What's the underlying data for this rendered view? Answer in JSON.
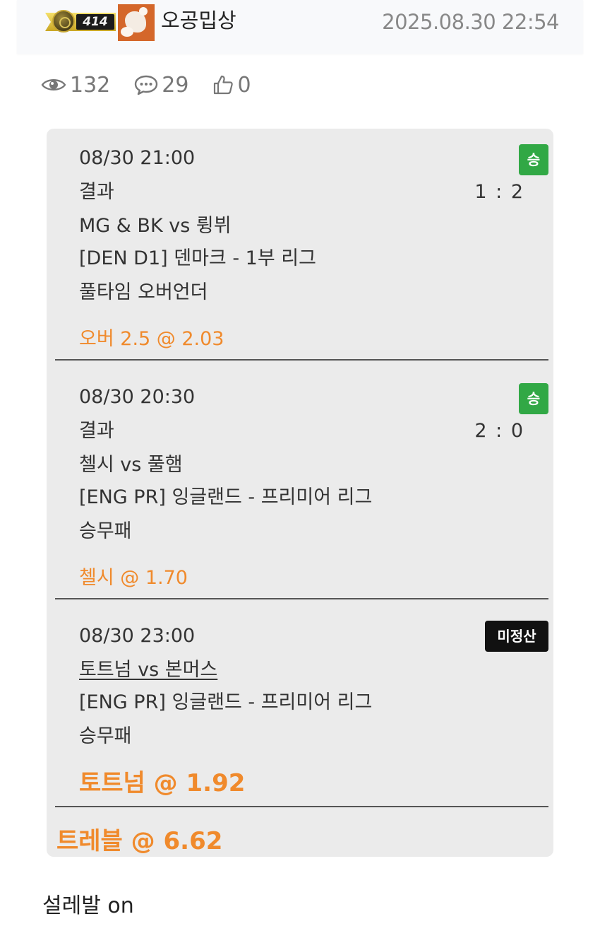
{
  "header": {
    "level": "414",
    "nickname": "오공밉상",
    "datetime": "2025.08.30 22:54"
  },
  "stats": {
    "views": "132",
    "comments": "29",
    "likes": "0"
  },
  "bets": [
    {
      "datetime": "08/30 21:00",
      "result_label": "결과",
      "score": "1 : 2",
      "match": "MG & BK vs 륑뷔",
      "league": "[DEN D1] 덴마크 - 1부 리그",
      "market": "풀타임 오버언더",
      "pick": "오버 2.5 @ 2.03",
      "status": "승",
      "status_color": "#31a845"
    },
    {
      "datetime": "08/30 20:30",
      "result_label": "결과",
      "score": "2 : 0",
      "match": "첼시 vs 풀햄",
      "league": "[ENG PR] 잉글랜드 - 프리미어 리그",
      "market": "승무패",
      "pick": "첼시 @ 1.70",
      "status": "승",
      "status_color": "#31a845"
    },
    {
      "datetime": "08/30 23:00",
      "match": "토트넘 vs 본머스",
      "league": "[ENG PR] 잉글랜드 - 프리미어 리그",
      "market": "승무패",
      "pick": "토트넘 @ 1.92",
      "status": "미정산",
      "status_color": "#111111"
    }
  ],
  "total": "트레블 @ 6.62",
  "footer_text": "설레발 on",
  "colors": {
    "pick_orange": "#f08a2c",
    "card_bg": "#ebebeb",
    "icon_gray": "#777777"
  },
  "icons": [
    "eye-icon",
    "comment-icon",
    "thumbs-up-icon"
  ]
}
